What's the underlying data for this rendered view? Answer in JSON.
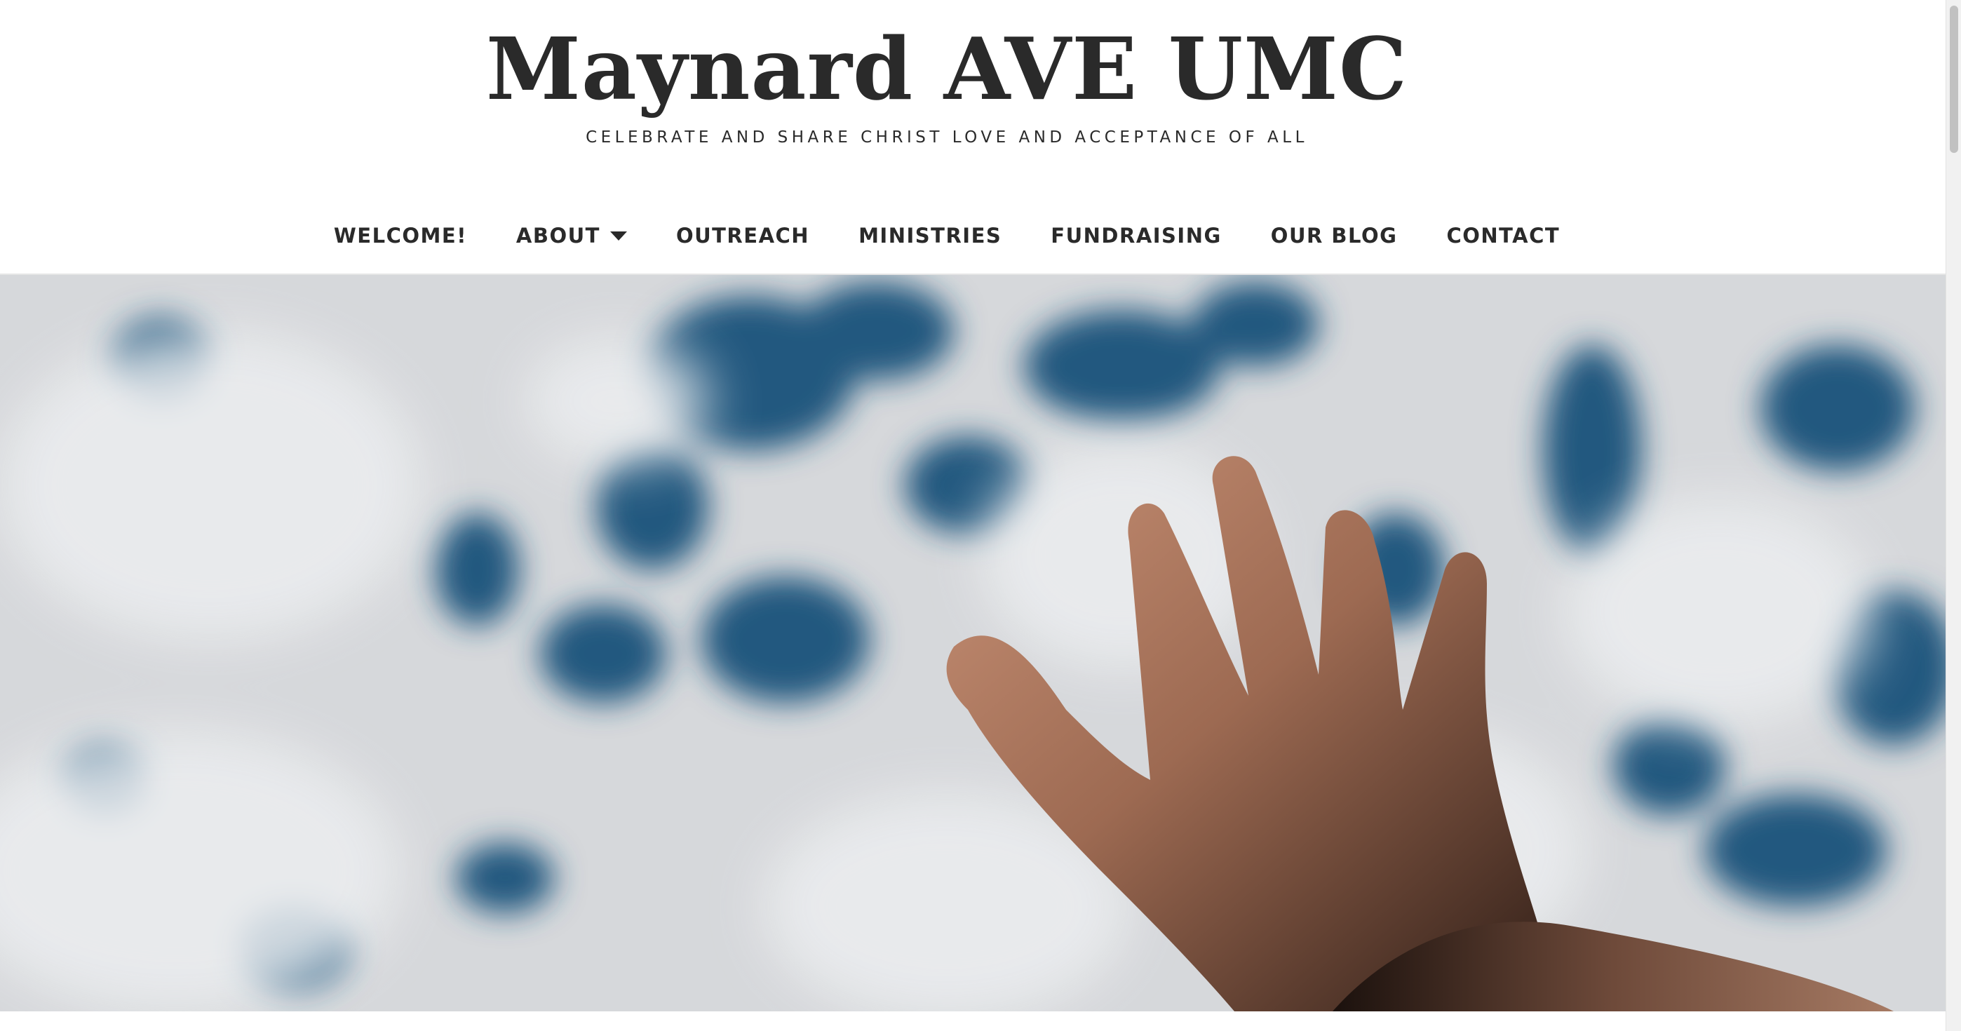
{
  "site": {
    "title": "Maynard AVE UMC",
    "tagline": "CELEBRATE AND SHARE CHRIST LOVE AND ACCEPTANCE OF ALL"
  },
  "nav": {
    "items": [
      {
        "label": "WELCOME!"
      },
      {
        "label": "ABOUT"
      },
      {
        "label": "OUTREACH"
      },
      {
        "label": "MINISTRIES"
      },
      {
        "label": "FUNDRAISING"
      },
      {
        "label": "OUR BLOG"
      },
      {
        "label": "CONTACT"
      }
    ]
  },
  "hero": {
    "image": "hand-reaching-to-cloudy-sky"
  },
  "colors": {
    "text": "#2a2a2a",
    "sky": "#2b5f86",
    "cloud": "#dfe1e4",
    "skin": "#b07a5e"
  },
  "icons": {
    "about_dropdown": "caret-down-icon"
  }
}
